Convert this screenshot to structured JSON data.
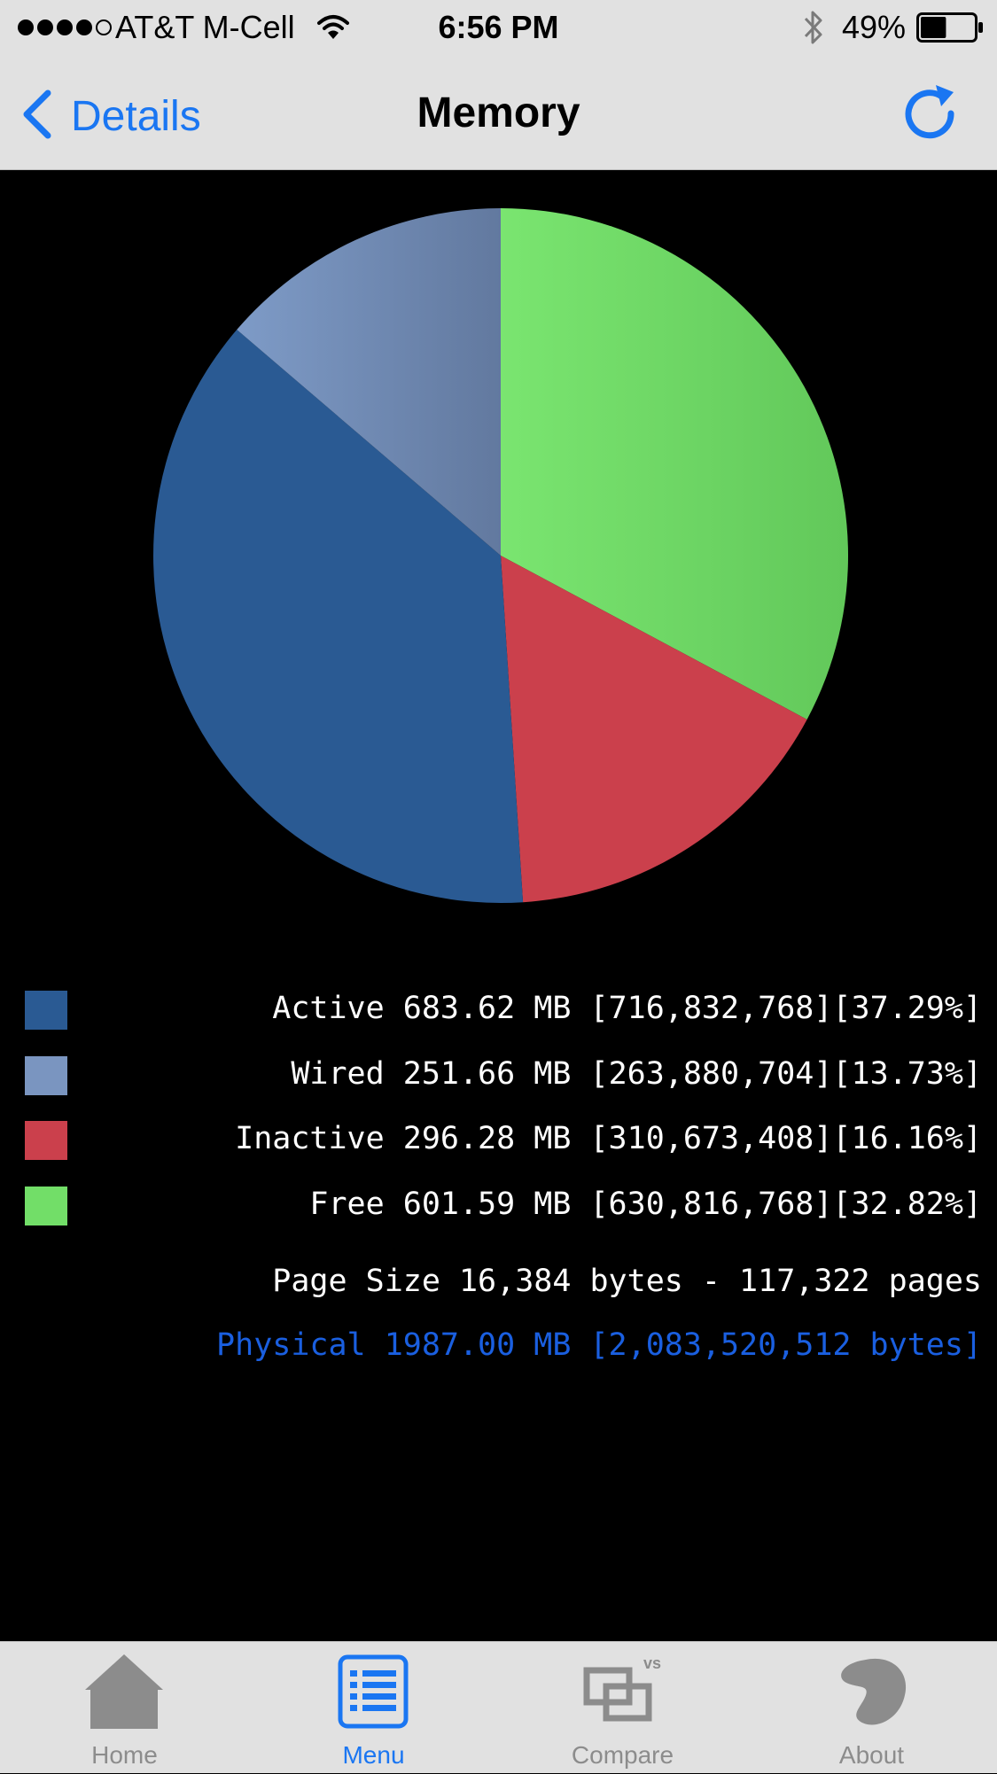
{
  "status_bar": {
    "carrier": "AT&T M-Cell",
    "time": "6:56 PM",
    "battery_percent": "49%",
    "battery_level": 0.49,
    "signal_bars_filled": 4,
    "signal_bars_total": 5
  },
  "nav": {
    "back_label": "Details",
    "title": "Memory"
  },
  "chart_data": {
    "type": "pie",
    "slices": [
      {
        "name": "Active",
        "percent": 37.29,
        "color": "#2a5a93"
      },
      {
        "name": "Wired",
        "percent": 13.73,
        "color": "#7a95c0"
      },
      {
        "name": "Inactive",
        "percent": 16.16,
        "color": "#cb404c"
      },
      {
        "name": "Free",
        "percent": 32.82,
        "color": "#72de68"
      }
    ],
    "drawn_order": [
      "Free",
      "Inactive",
      "Active",
      "Wired"
    ],
    "drawn_colors": {
      "Free": "#72de68",
      "Inactive": "#cb404c",
      "Active": "#2a5a93",
      "Wired": "#7087b2"
    }
  },
  "legend": [
    {
      "text": "Active 683.62 MB [716,832,768][37.29%]",
      "color": "#2a5a93"
    },
    {
      "text": "Wired 251.66 MB [263,880,704][13.73%]",
      "color": "#7a95c0"
    },
    {
      "text": "Inactive 296.28 MB [310,673,408][16.16%]",
      "color": "#cb404c"
    },
    {
      "text": "Free 601.59 MB [630,816,768][32.82%]",
      "color": "#72de68"
    }
  ],
  "page_size_text": "Page Size 16,384 bytes - 117,322 pages",
  "physical_text": "Physical 1987.00 MB [2,083,520,512 bytes]",
  "tabs": [
    {
      "label": "Home",
      "selected": false
    },
    {
      "label": "Menu",
      "selected": true
    },
    {
      "label": "Compare",
      "selected": false,
      "badge": "vs"
    },
    {
      "label": "About",
      "selected": false
    }
  ],
  "colors": {
    "accent": "#1a76f2",
    "physical_text": "#1a5fe0",
    "bar_bg": "#e1e1e1",
    "tab_inactive": "#8c8c8c"
  }
}
